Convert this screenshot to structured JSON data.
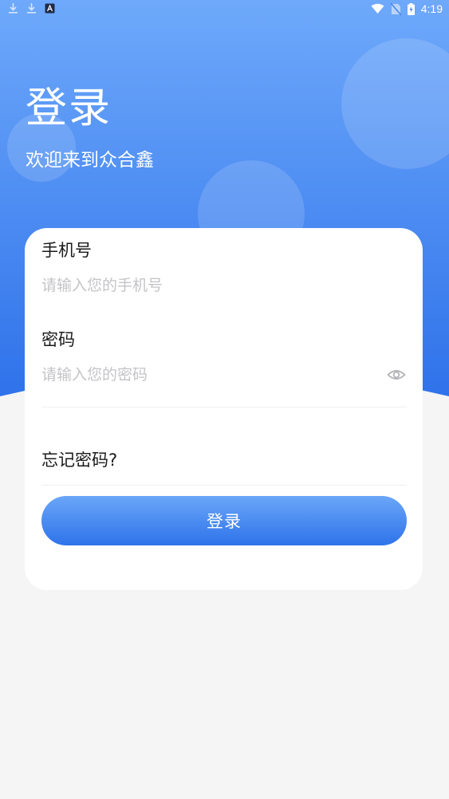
{
  "status_bar": {
    "time": "4:19",
    "icons": [
      "download-icon",
      "download-icon",
      "app-a-icon",
      "wifi-icon",
      "no-sim-icon",
      "battery-icon"
    ]
  },
  "header": {
    "title": "登录",
    "subtitle": "欢迎来到众合鑫"
  },
  "form": {
    "phone_label": "手机号",
    "phone_placeholder": "请输入您的手机号",
    "password_label": "密码",
    "password_placeholder": "请输入您的密码",
    "forgot_password": "忘记密码?",
    "login_button": "登录"
  },
  "colors": {
    "primary": "#2e73ea",
    "primary_light": "#6aa6f8",
    "background": "#f5f5f5",
    "card": "#ffffff",
    "placeholder": "#c4c4c8"
  }
}
